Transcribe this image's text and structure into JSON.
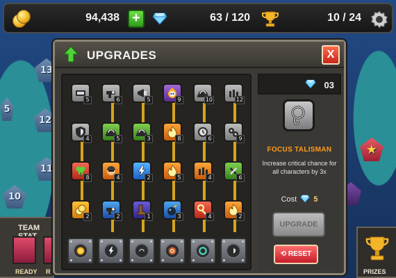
{
  "topbar": {
    "coins": "94,438",
    "add_button": "+",
    "gems": "63 / 120",
    "trophies": "10 / 24"
  },
  "map": {
    "nodes": [
      "13",
      "12",
      "11",
      "10",
      "5"
    ]
  },
  "panel": {
    "title": "UPGRADES",
    "close_label": "X"
  },
  "tree": {
    "rows": [
      [
        {
          "icon": "ammo-icon",
          "color": "gray",
          "level": "5"
        },
        {
          "icon": "gun-icon",
          "color": "gray",
          "level": "6"
        },
        {
          "icon": "horn-icon",
          "color": "gray",
          "level": "5"
        },
        {
          "icon": "skull-fire-icon",
          "color": "purple",
          "level": "9"
        },
        {
          "icon": "helmet-icon",
          "color": "gray",
          "level": "10"
        },
        {
          "icon": "bullets-icon",
          "color": "gray",
          "level": "12"
        }
      ],
      [
        {
          "icon": "shield-icon",
          "color": "gray",
          "level": "4"
        },
        {
          "icon": "helmet-icon",
          "color": "green",
          "level": "5"
        },
        {
          "icon": "helmet-icon",
          "color": "green",
          "level": "3"
        },
        {
          "icon": "fire-icon",
          "color": "orange",
          "level": "8"
        },
        {
          "icon": "clock-icon",
          "color": "gray",
          "level": "6"
        },
        {
          "icon": "gears-icon",
          "color": "gray",
          "level": "9"
        }
      ],
      [
        {
          "icon": "clover-icon",
          "color": "red",
          "level": "8"
        },
        {
          "icon": "soldier-icon",
          "color": "orange",
          "level": "4"
        },
        {
          "icon": "lightning-icon",
          "color": "blue",
          "level": "2"
        },
        {
          "icon": "fire-icon",
          "color": "orange",
          "level": "5"
        },
        {
          "icon": "bullets-icon",
          "color": "orange",
          "level": "4"
        },
        {
          "icon": "tools-icon",
          "color": "green",
          "level": "6"
        }
      ],
      [
        {
          "icon": "coins-icon",
          "color": "gold",
          "level": "2"
        },
        {
          "icon": "gun-icon",
          "color": "azure",
          "level": "2"
        },
        {
          "icon": "boot-icon",
          "color": "indigo",
          "level": "1"
        },
        {
          "icon": "bomb-icon",
          "color": "azure",
          "level": "3"
        },
        {
          "icon": "key-icon",
          "color": "red",
          "level": "4"
        },
        {
          "icon": "fire-icon",
          "color": "orange",
          "level": "2"
        }
      ]
    ],
    "bases": [
      "coin-icon",
      "lightning-icon",
      "helmet-icon",
      "target-icon",
      "ring-icon",
      "shield-icon"
    ]
  },
  "detail": {
    "gems": "03",
    "item_name": "FOCUS TALISMAN",
    "description": "Increase critical chance for all characters by 3x",
    "cost_label": "Cost",
    "cost_value": "5",
    "upgrade_label": "UPGRADE",
    "reset_label": "RESET"
  },
  "team": {
    "title": "TEAM STAT",
    "status_1": "READY",
    "status_2": "R"
  },
  "prizes": {
    "label": "PRIZES"
  },
  "colors": {
    "gray": "#a0a0a0",
    "purple": "#7c46b4",
    "green": "#55a834",
    "orange": "#e67c1c",
    "red": "#d8442e",
    "blue": "#3a8ae6",
    "indigo": "#4a3cb0",
    "gold": "#ea9d1c",
    "azure": "#3278d0",
    "connector": "#d6a41c",
    "accent": "#ff9d1f"
  }
}
